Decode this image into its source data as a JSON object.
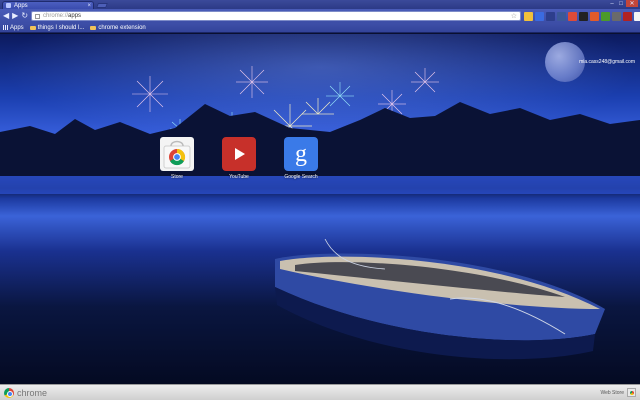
{
  "window": {
    "tab_title": "Apps",
    "tab_close": "×",
    "minimize": "–",
    "maximize": "□",
    "close": "✕"
  },
  "toolbar": {
    "back": "◀",
    "forward": "▶",
    "reload": "↻",
    "url_scheme": "chrome://",
    "url_path": "apps",
    "star": "☆",
    "menu": "≡",
    "extensions": [
      {
        "name": "ext-1",
        "color": "#f2c13a"
      },
      {
        "name": "ext-2",
        "color": "#3b6be0"
      },
      {
        "name": "ext-3",
        "color": "#2d3e8c"
      },
      {
        "name": "ext-4",
        "color": "#3b5998"
      },
      {
        "name": "ext-5",
        "color": "#dd4b39"
      },
      {
        "name": "ext-6",
        "color": "#222222"
      },
      {
        "name": "ext-7",
        "color": "#e25b2a"
      },
      {
        "name": "ext-8",
        "color": "#4c9a2a"
      },
      {
        "name": "ext-9",
        "color": "#6a6a6a"
      },
      {
        "name": "ext-10",
        "color": "#b22222"
      },
      {
        "name": "ext-11",
        "color": "#f5f5f5"
      }
    ]
  },
  "bookmarks": {
    "apps_label": "Apps",
    "items": [
      {
        "label": "things I should l..."
      },
      {
        "label": "chrome extension"
      }
    ]
  },
  "main": {
    "user_email": "mia.cass248@gmail.com",
    "apps": [
      {
        "label": "Store",
        "icon": "chrome-web-store-icon"
      },
      {
        "label": "YouTube",
        "icon": "youtube-play-icon"
      },
      {
        "label": "Google Search",
        "icon": "google-g-icon"
      }
    ]
  },
  "footer": {
    "brand": "chrome",
    "webstore_label": "Web Store"
  }
}
